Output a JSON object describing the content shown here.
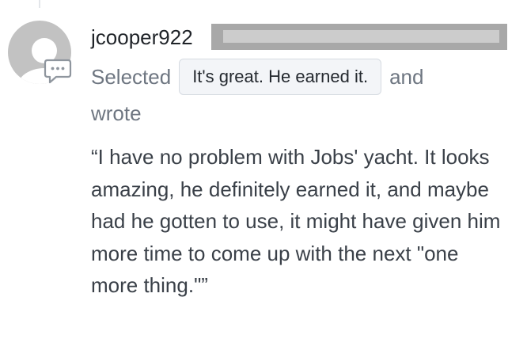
{
  "comment": {
    "username": "jcooper922",
    "selected_label": "Selected",
    "selected_option": "It's great. He earned it.",
    "and_label": "and",
    "wrote_label": "wrote",
    "quote_text": "“I have no problem with Jobs' yacht. It looks amazing, he definitely earned it, and maybe had he gotten to use, it might have given him more time to come up with the next \"one more thing.\"”"
  },
  "icons": {
    "avatar": "default-user-avatar-icon",
    "badge": "comment-bubble-icon"
  },
  "colors": {
    "avatar_gray": "#c2c2c2",
    "redaction": "#a8a8a8",
    "chip_bg": "#f3f5f8",
    "chip_border": "#d6dbe1",
    "muted_text": "#6e7681"
  }
}
